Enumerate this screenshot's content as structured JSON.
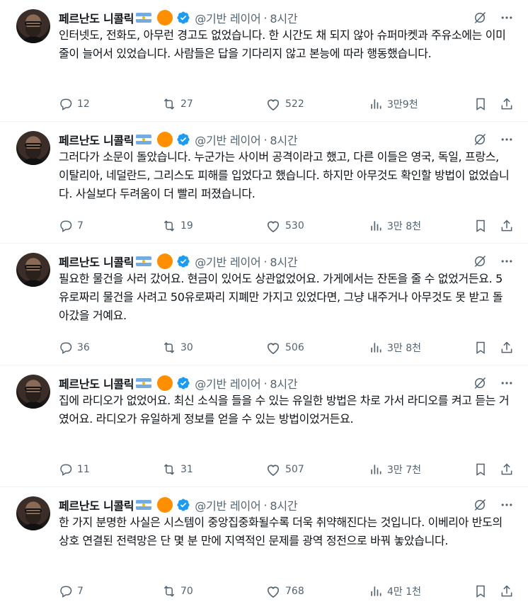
{
  "colors": {
    "text": "#0f1419",
    "secondary": "#536471",
    "verified": "#1d9bf0",
    "badge_orange": "#ff8f00"
  },
  "icons": {
    "grok": "grok-slash-circle-icon",
    "more": "more-dots-icon",
    "reply": "reply-bubble-icon",
    "retweet": "retweet-icon",
    "like": "heart-icon",
    "views": "views-bars-icon",
    "bookmark": "bookmark-icon",
    "share": "share-upload-icon",
    "verified": "verified-badge-icon"
  },
  "tweets": [
    {
      "author": "페르난도 니콜릭",
      "handle": "@기반 레이어",
      "sep": "·",
      "time": "8시간",
      "text": "인터넷도, 전화도, 아무런 경고도 없었습니다. 한 시간도 채 되지 않아 슈퍼마켓과 주유소에는 이미 줄이 늘어서 있었습니다. 사람들은 답을 기다리지 않고 본능에 따라 행동했습니다.",
      "replies": "12",
      "retweets": "27",
      "likes": "522",
      "views": "3만9천"
    },
    {
      "author": "페르난도 니콜릭",
      "handle": "@기반 레이어",
      "sep": "·",
      "time": "8시간",
      "text": "그러다가 소문이 돌았습니다. 누군가는 사이버 공격이라고 했고, 다른 이들은 영국, 독일, 프랑스, 이탈리아, 네덜란드, 그리스도 피해를 입었다고 했습니다. 하지만 아무것도 확인할 방법이 없었습니다. 사실보다 두려움이 더 빨리 퍼졌습니다.",
      "replies": "7",
      "retweets": "19",
      "likes": "530",
      "views": "3만 8천"
    },
    {
      "author": "페르난도 니콜릭",
      "handle": "@기반 레이어",
      "sep": "·",
      "time": "8시간",
      "text": "필요한 물건을 사러 갔어요. 현금이 있어도 상관없었어요. 가게에서는 잔돈을 줄 수 없었거든요. 5유로짜리 물건을 사려고 50유로짜리 지폐만 가지고 있었다면, 그냥 내주거나 아무것도 못 받고 돌아갔을 거예요.",
      "replies": "36",
      "retweets": "30",
      "likes": "506",
      "views": "3만 8천"
    },
    {
      "author": "페르난도 니콜릭",
      "handle": "@기반 레이어",
      "sep": "·",
      "time": "8시간",
      "text": "집에 라디오가 없었어요. 최신 소식을 들을 수 있는 유일한 방법은 차로 가서 라디오를 켜고 듣는 거였어요. 라디오가 유일하게 정보를 얻을 수 있는 방법이었거든요.",
      "replies": "11",
      "retweets": "31",
      "likes": "507",
      "views": "3만 7천"
    },
    {
      "author": "페르난도 니콜릭",
      "handle": "@기반 레이어",
      "sep": "·",
      "time": "8시간",
      "text": "한 가지 분명한 사실은 시스템이 중앙집중화될수록 더욱 취약해진다는 것입니다. 이베리아 반도의 상호 연결된 전력망은 단 몇 분 만에 지역적인 문제를 광역 정전으로 바꿔 놓았습니다.",
      "replies": "7",
      "retweets": "70",
      "likes": "768",
      "views": "4만 1천"
    }
  ]
}
